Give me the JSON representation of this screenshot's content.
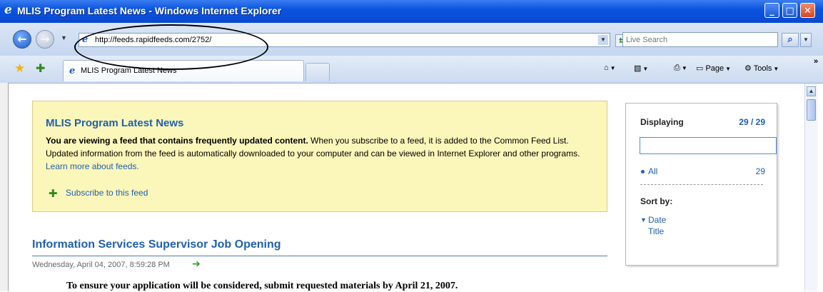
{
  "window": {
    "title": "MLIS Program Latest News - Windows Internet Explorer",
    "minimize_icon": "minimize-icon",
    "maximize_icon": "maximize-icon",
    "close_icon": "close-icon"
  },
  "address_bar": {
    "url": "http://feeds.rapidfeeds.com/2752/"
  },
  "search": {
    "placeholder": "Live Search"
  },
  "tab": {
    "label": "MLIS Program Latest News"
  },
  "command_bar": {
    "page_label": "Page",
    "tools_label": "Tools"
  },
  "feed_box": {
    "title": "MLIS Program Latest News",
    "description_bold": "You are viewing a feed that contains frequently updated content.",
    "description_rest": " When you subscribe to a feed, it is added to the Common Feed List. Updated information from the feed is automatically downloaded to your computer and can be viewed in Internet Explorer and other programs. ",
    "learn_more": "Learn more about feeds.",
    "subscribe_label": "Subscribe to this feed"
  },
  "side_panel": {
    "displaying_label": "Displaying",
    "displaying_count": "29 / 29",
    "all_label": "All",
    "all_count": "29",
    "sort_by_label": "Sort by:",
    "sort_options": [
      "Date",
      "Title"
    ]
  },
  "article": {
    "title": "Information Services Supervisor Job Opening",
    "date": "Wednesday, April 04, 2007, 8:59:28 PM",
    "body": "To ensure your application will be considered, submit requested materials by April 21, 2007."
  },
  "colors": {
    "link_blue": "#1f60b0",
    "feed_box_bg": "#fbf6b9",
    "titlebar_blue": "#0a54e0"
  }
}
